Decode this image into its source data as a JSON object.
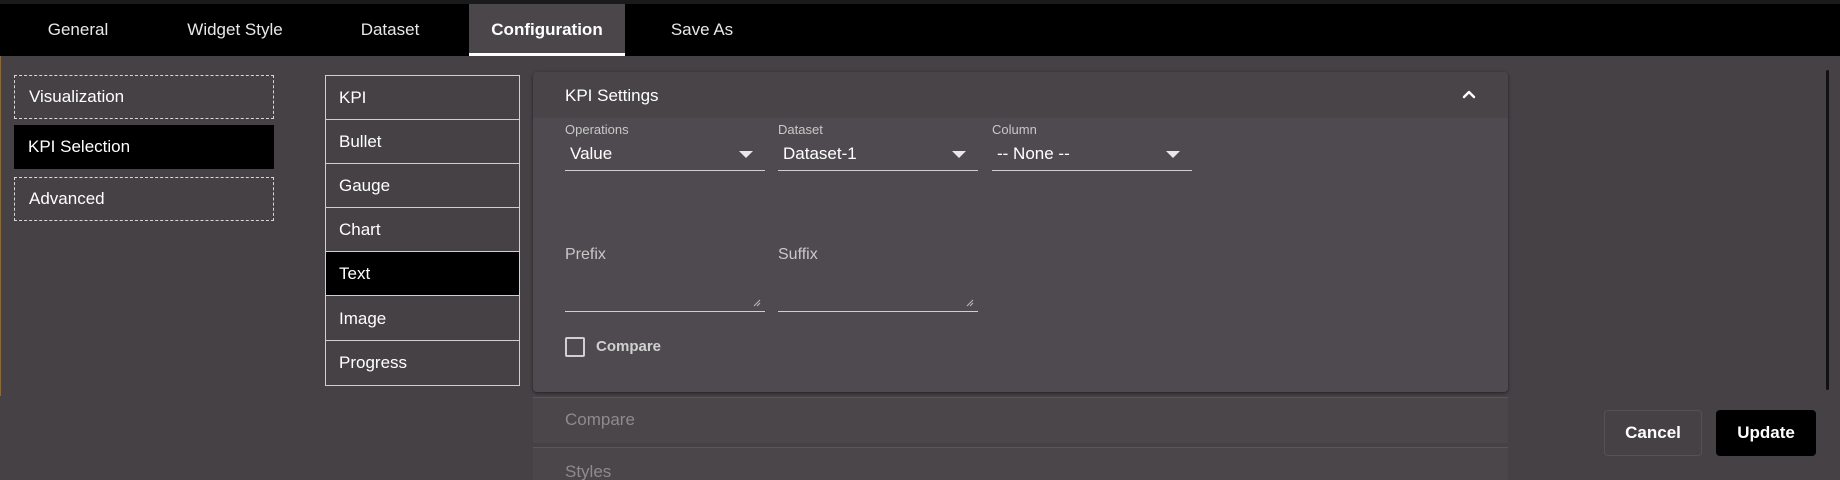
{
  "tabs": [
    {
      "label": "General"
    },
    {
      "label": "Widget Style"
    },
    {
      "label": "Dataset"
    },
    {
      "label": "Configuration"
    },
    {
      "label": "Save As"
    }
  ],
  "active_tab": "Configuration",
  "left_menu": [
    {
      "label": "Visualization"
    },
    {
      "label": "KPI Selection"
    },
    {
      "label": "Advanced"
    }
  ],
  "kpi_types": [
    {
      "label": "KPI"
    },
    {
      "label": "Bullet"
    },
    {
      "label": "Gauge"
    },
    {
      "label": "Chart"
    },
    {
      "label": "Text"
    },
    {
      "label": "Image"
    },
    {
      "label": "Progress"
    }
  ],
  "active_kpi_type": "Text",
  "settings": {
    "title": "KPI Settings",
    "operations": {
      "label": "Operations",
      "value": "Value"
    },
    "dataset": {
      "label": "Dataset",
      "value": "Dataset-1"
    },
    "column": {
      "label": "Column",
      "value": "-- None --"
    },
    "prefix": {
      "label": "Prefix",
      "value": ""
    },
    "suffix": {
      "label": "Suffix",
      "value": ""
    },
    "compare": {
      "label": "Compare",
      "checked": false
    }
  },
  "sections": [
    {
      "label": "Compare"
    },
    {
      "label": "Styles"
    }
  ],
  "buttons": {
    "cancel": "Cancel",
    "update": "Update"
  },
  "colors": {
    "background": "#454145",
    "topbar": "#000000",
    "active_item": "#000000",
    "panel": "#4f4a4f"
  }
}
